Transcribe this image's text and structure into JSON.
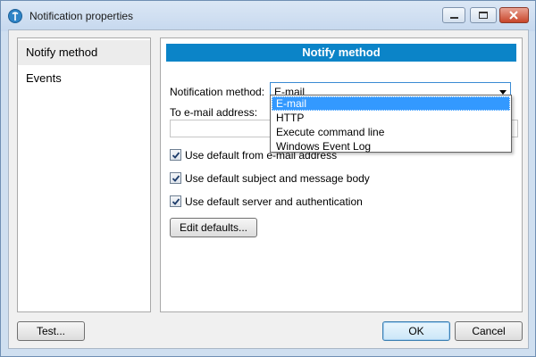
{
  "window": {
    "title": "Notification properties"
  },
  "sidebar": {
    "items": [
      {
        "label": "Notify method"
      },
      {
        "label": "Events"
      }
    ]
  },
  "panel": {
    "header": "Notify method",
    "method_label": "Notification method:",
    "method_value": "E-mail",
    "email_label": "To e-mail address:",
    "email_value": "",
    "checkboxes": [
      {
        "label": "Use default from e-mail address",
        "checked": true
      },
      {
        "label": "Use default subject and message body",
        "checked": true
      },
      {
        "label": "Use default server and authentication",
        "checked": true
      }
    ],
    "edit_defaults_label": "Edit defaults..."
  },
  "dropdown": {
    "options": [
      "E-mail",
      "HTTP",
      "Execute command line",
      "Windows Event Log"
    ],
    "selected": "E-mail"
  },
  "footer": {
    "test_label": "Test...",
    "ok_label": "OK",
    "cancel_label": "Cancel"
  },
  "colors": {
    "header_bg": "#0b84c8",
    "selection": "#3399ff"
  }
}
